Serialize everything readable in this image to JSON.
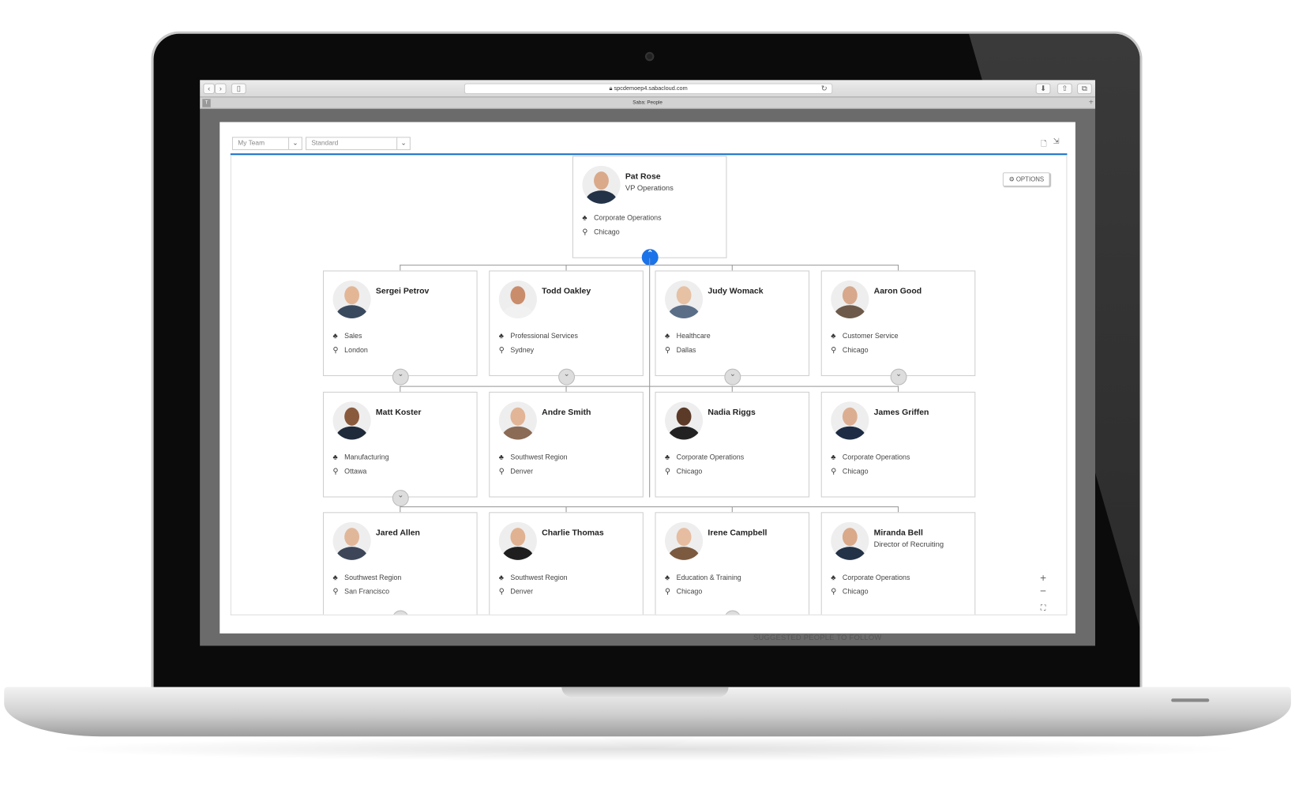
{
  "browser": {
    "url": "spcdemoep4.sabacloud.com",
    "tab_title": "Saba: People",
    "tab_badge": "T"
  },
  "filters": {
    "view": "My Team",
    "layout": "Standard"
  },
  "options_label": "OPTIONS",
  "zoom": {
    "in": "+",
    "out": "−",
    "fit": "⛶"
  },
  "footer_text": "SUGGESTED PEOPLE TO FOLLOW",
  "root": {
    "name": "Pat Rose",
    "title": "VP Operations",
    "org": "Corporate Operations",
    "location": "Chicago",
    "expanded": true
  },
  "people": [
    {
      "name": "Sergei Petrov",
      "title": "",
      "org": "Sales",
      "location": "London",
      "has_reports": true
    },
    {
      "name": "Todd Oakley",
      "title": "",
      "org": "Professional Services",
      "location": "Sydney",
      "has_reports": true
    },
    {
      "name": "Judy Womack",
      "title": "",
      "org": "Healthcare",
      "location": "Dallas",
      "has_reports": true
    },
    {
      "name": "Aaron Good",
      "title": "",
      "org": "Customer Service",
      "location": "Chicago",
      "has_reports": true
    },
    {
      "name": "Matt Koster",
      "title": "",
      "org": "Manufacturing",
      "location": "Ottawa",
      "has_reports": true
    },
    {
      "name": "Andre Smith",
      "title": "",
      "org": "Southwest Region",
      "location": "Denver",
      "has_reports": false
    },
    {
      "name": "Nadia Riggs",
      "title": "",
      "org": "Corporate Operations",
      "location": "Chicago",
      "has_reports": false
    },
    {
      "name": "James Griffen",
      "title": "",
      "org": "Corporate Operations",
      "location": "Chicago",
      "has_reports": false
    },
    {
      "name": "Jared Allen",
      "title": "",
      "org": "Southwest Region",
      "location": "San Francisco",
      "has_reports": true
    },
    {
      "name": "Charlie Thomas",
      "title": "",
      "org": "Southwest Region",
      "location": "Denver",
      "has_reports": false
    },
    {
      "name": "Irene Campbell",
      "title": "",
      "org": "Education & Training",
      "location": "Chicago",
      "has_reports": true
    },
    {
      "name": "Miranda Bell",
      "title": "Director of Recruiting",
      "org": "Corporate Operations",
      "location": "Chicago",
      "has_reports": false
    }
  ],
  "colors": {
    "accent": "#1a73c8",
    "expand_active": "#1a73e8"
  }
}
